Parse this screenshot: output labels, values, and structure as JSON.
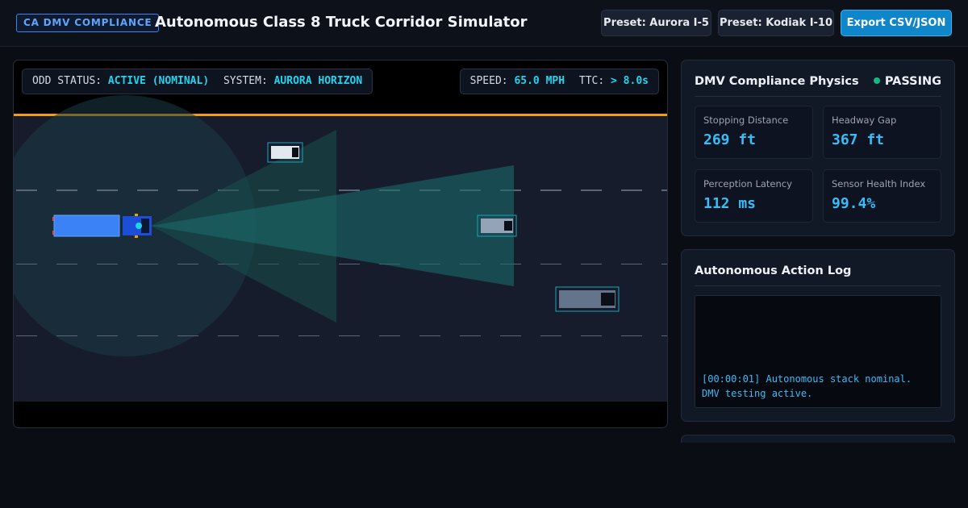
{
  "header": {
    "badge": "CA DMV COMPLIANCE",
    "title": "Autonomous Class 8 Truck Corridor Simulator",
    "buttons": {
      "preset_aurora": "Preset: Aurora I-5",
      "preset_kodiak": "Preset: Kodiak I-10",
      "export": "Export CSV/JSON"
    }
  },
  "hud": {
    "odd_label": "ODD STATUS:",
    "odd_value": "ACTIVE (NOMINAL)",
    "system_label": "SYSTEM:",
    "system_value": "AURORA HORIZON",
    "speed_label": "SPEED:",
    "speed_value": "65.0 MPH",
    "ttc_label": "TTC:",
    "ttc_value": "> 8.0s"
  },
  "physics": {
    "title": "DMV Compliance Physics",
    "status": "PASSING",
    "metrics": [
      {
        "label": "Stopping Distance",
        "value": "269 ft"
      },
      {
        "label": "Headway Gap",
        "value": "367 ft"
      },
      {
        "label": "Perception Latency",
        "value": "112 ms"
      },
      {
        "label": "Sensor Health Index",
        "value": "99.4%"
      }
    ]
  },
  "log": {
    "title": "Autonomous Action Log",
    "entries": [
      "[00:00:01] Autonomous stack nominal. DMV testing active."
    ]
  },
  "colors": {
    "accent": "#38bdf8",
    "hud_value": "#22d3ee",
    "road_edge": "#f59e0b",
    "truck": "#3b82f6",
    "status_ok": "#10b981"
  }
}
